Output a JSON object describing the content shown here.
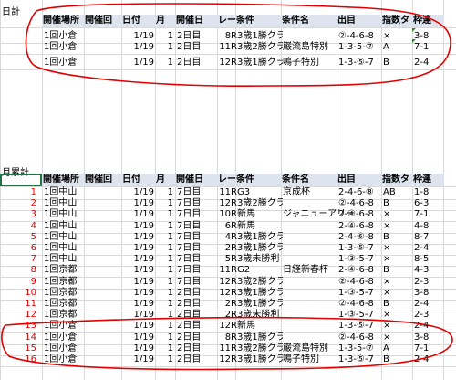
{
  "colors": {
    "header_fill": "#dde4ee",
    "gridline": "#d9d9d9",
    "row_number": "#e00000",
    "annotation": "#e00000",
    "comment_marker": "#2e8b2e"
  },
  "section1": {
    "title": "日計",
    "headers": [
      "開催場所",
      "開催回",
      "日付",
      "月",
      "開催日",
      "レース",
      "条件",
      "条件名",
      "出目",
      "指数タ",
      "枠連"
    ],
    "rows": [
      {
        "place": "1回小倉",
        "date": "1/19",
        "month": "1",
        "day": "2日目",
        "race": "8R",
        "cond": "3歳1勝クラ",
        "name": "",
        "deme": "②-4-6-8",
        "idx": "×",
        "waku": "3-8"
      },
      {
        "place": "1回小倉",
        "date": "1/19",
        "month": "1",
        "day": "2日目",
        "race": "11R",
        "cond": "3歳2勝クラ",
        "name": "巌流島特別",
        "deme": "1-3-5-⑦",
        "idx": "A",
        "waku": "7-1"
      },
      {
        "place": "1回小倉",
        "date": "1/19",
        "month": "1",
        "day": "2日目",
        "race": "12R",
        "cond": "3歳1勝クラ",
        "name": "鳴子特別",
        "deme": "1-3-⑤-7",
        "idx": "B",
        "waku": "2-4"
      }
    ]
  },
  "section2": {
    "title": "月累計",
    "headers": [
      "開催場所",
      "開催回",
      "日付",
      "月",
      "開催日",
      "レース",
      "条件",
      "条件名",
      "出目",
      "指数タ",
      "枠連"
    ],
    "rows": [
      {
        "no": "1",
        "place": "1回中山",
        "date": "1/19",
        "month": "1",
        "day": "7日目",
        "race": "11R",
        "cond": "G3",
        "name": "京成杯",
        "deme": "2-4-6-⑧",
        "idx": "AB",
        "waku": "1-8"
      },
      {
        "no": "2",
        "place": "1回中山",
        "date": "1/19",
        "month": "1",
        "day": "7日目",
        "race": "12R",
        "cond": "3歳2勝クラ",
        "name": "",
        "deme": "②-4-6-8",
        "idx": "B",
        "waku": "6-3"
      },
      {
        "no": "3",
        "place": "1回中山",
        "date": "1/19",
        "month": "1",
        "day": "7日目",
        "race": "10R",
        "cond": "新馬",
        "name": "ジャニューアリー",
        "deme": "2-④-6-8",
        "idx": "×",
        "waku": "7-1"
      },
      {
        "no": "4",
        "place": "1回中山",
        "date": "1/19",
        "month": "1",
        "day": "7日目",
        "race": "6R",
        "cond": "新馬",
        "name": "",
        "deme": "2-④-6-8",
        "idx": "×",
        "waku": "4-8"
      },
      {
        "no": "5",
        "place": "1回中山",
        "date": "1/19",
        "month": "1",
        "day": "7日目",
        "race": "4R",
        "cond": "3歳1勝クラ",
        "name": "",
        "deme": "2-4-⑥-8",
        "idx": "B",
        "waku": "8-7"
      },
      {
        "no": "6",
        "place": "1回中山",
        "date": "1/19",
        "month": "1",
        "day": "7日目",
        "race": "2R",
        "cond": "3歳1勝クラ",
        "name": "",
        "deme": "1-3-⑤-7",
        "idx": "×",
        "waku": "2-4"
      },
      {
        "no": "7",
        "place": "1回中山",
        "date": "1/19",
        "month": "1",
        "day": "7日目",
        "race": "5R",
        "cond": "3歳未勝利",
        "name": "",
        "deme": "1-③-5-7",
        "idx": "×",
        "waku": "8-5"
      },
      {
        "no": "8",
        "place": "1回京都",
        "date": "1/19",
        "month": "1",
        "day": "7日目",
        "race": "11R",
        "cond": "G2",
        "name": "日経新春杯",
        "deme": "2-④-6-8",
        "idx": "B",
        "waku": "4-3"
      },
      {
        "no": "9",
        "place": "1回京都",
        "date": "1/19",
        "month": "1",
        "day": "7日目",
        "race": "12R",
        "cond": "3歳2勝クラ",
        "name": "",
        "deme": "②-4-6-8",
        "idx": "×",
        "waku": "2-3"
      },
      {
        "no": "10",
        "place": "1回京都",
        "date": "1/19",
        "month": "1",
        "day": "2日目",
        "race": "12R",
        "cond": "3歳1勝クラ",
        "name": "",
        "deme": "1-③-5-7",
        "idx": "×",
        "waku": "3-8"
      },
      {
        "no": "11",
        "place": "1回京都",
        "date": "1/19",
        "month": "1",
        "day": "2日目",
        "race": "2R",
        "cond": "3歳1勝クラ",
        "name": "",
        "deme": "②-4-6-8",
        "idx": "B",
        "waku": "2-4"
      },
      {
        "no": "12",
        "place": "1回京都",
        "date": "1/19",
        "month": "1",
        "day": "2日目",
        "race": "2R",
        "cond": "3歳未勝利",
        "name": "",
        "deme": "1-③-5-7",
        "idx": "×",
        "waku": "2-3"
      },
      {
        "no": "13",
        "place": "1回小倉",
        "date": "1/19",
        "month": "1",
        "day": "2日目",
        "race": "12R",
        "cond": "新馬",
        "name": "",
        "deme": "1-3-⑤-7",
        "idx": "×",
        "waku": "2-4"
      },
      {
        "no": "14",
        "place": "1回小倉",
        "date": "1/19",
        "month": "1",
        "day": "2日目",
        "race": "8R",
        "cond": "3歳1勝クラ",
        "name": "",
        "deme": "②-4-6-8",
        "idx": "×",
        "waku": "3-8"
      },
      {
        "no": "15",
        "place": "1回小倉",
        "date": "1/19",
        "month": "1",
        "day": "2日目",
        "race": "11R",
        "cond": "3歳2勝クラ",
        "name": "巌流島特別",
        "deme": "1-3-5-⑦",
        "idx": "A",
        "waku": "7-1"
      },
      {
        "no": "16",
        "place": "1回小倉",
        "date": "1/19",
        "month": "1",
        "day": "2日目",
        "race": "12R",
        "cond": "3歳1勝クラ",
        "name": "鳴子特別",
        "deme": "1-3-⑤-7",
        "idx": "B",
        "waku": "2-4"
      }
    ]
  }
}
